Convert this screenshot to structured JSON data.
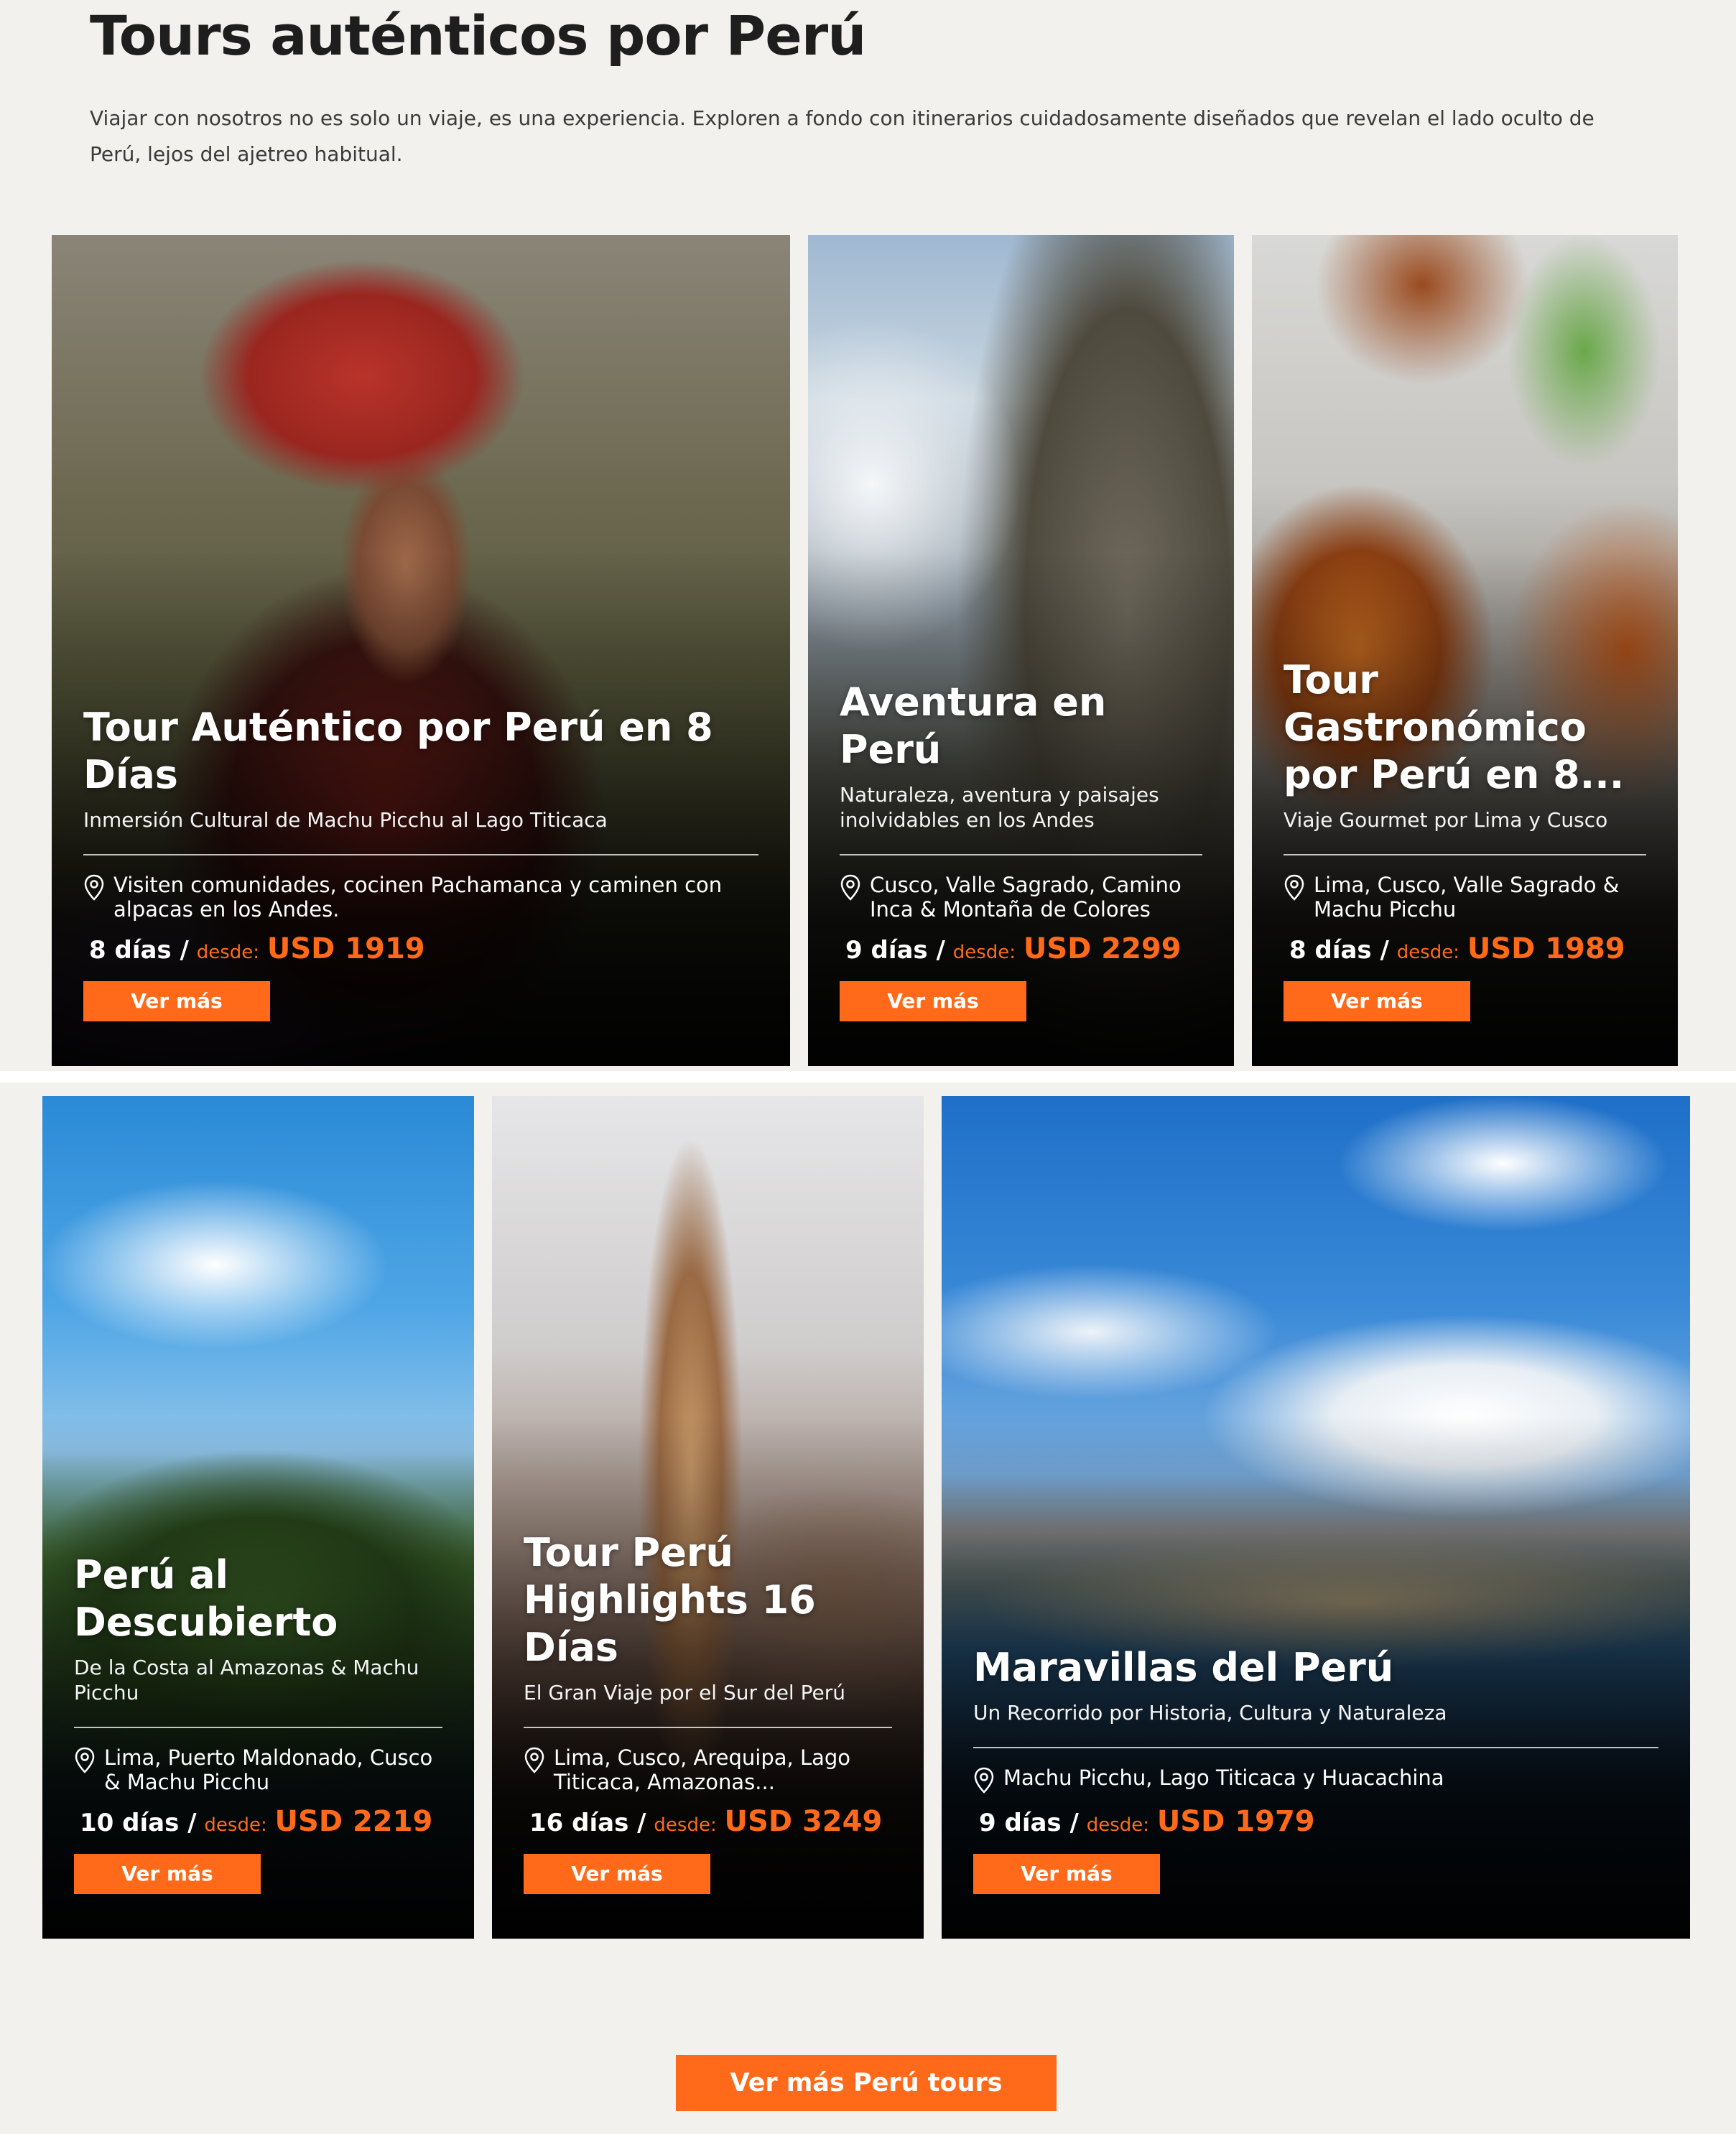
{
  "header": {
    "title": "Tours auténticos por Perú",
    "intro": "Viajar con nosotros no es solo un viaje, es una experiencia. Exploren a fondo con itinerarios cuidadosamente diseñados que revelan el lado oculto de Perú, lejos del ajetreo habitual."
  },
  "cards": [
    {
      "title": "Tour Auténtico por Perú en 8 Días",
      "subtitle": "Inmersión Cultural de Machu Picchu al Lago Titicaca",
      "location": "Visiten comunidades, cocinen Pachamanca y caminen con alpacas en los Andes.",
      "days": "8 días /",
      "from": "desde:",
      "price": "USD 1919",
      "button": "Ver más",
      "image": "woman in red traditional hat"
    },
    {
      "title": "Aventura en Perú",
      "subtitle": "Naturaleza, aventura y paisajes inolvidables en los Andes",
      "location": "Cusco, Valle Sagrado, Camino Inca & Montaña de Colores",
      "days": "9 días /",
      "from": "desde:",
      "price": "USD 2299",
      "button": "Ver más",
      "image": "rocky mountain ridge above clouds"
    },
    {
      "title": "Tour Gastronómico por Perú en 8...",
      "subtitle": "Viaje Gourmet por Lima y Cusco",
      "location": "Lima, Cusco, Valle Sagrado & Machu Picchu",
      "days": "8 días /",
      "from": "desde:",
      "price": "USD 1989",
      "button": "Ver más",
      "image": "peruvian dishes on table"
    },
    {
      "title": "Perú al Descubierto",
      "subtitle": "De la Costa al Amazonas & Machu Picchu",
      "location": "Lima, Puerto Maldonado, Cusco & Machu Picchu",
      "days": "10 días /",
      "from": "desde:",
      "price": "USD 2219",
      "button": "Ver más",
      "image": "amazon jungle and river"
    },
    {
      "title": "Tour Perú Highlights 16 Días",
      "subtitle": "El Gran Viaje por el Sur del Perú",
      "location": "Lima, Cusco, Arequipa, Lago Titicaca, Amazonas...",
      "days": "16 días /",
      "from": "desde:",
      "price": "USD 3249",
      "button": "Ver más",
      "image": "arequipa cathedral bell tower"
    },
    {
      "title": "Maravillas del Perú",
      "subtitle": "Un Recorrido por Historia, Cultura y Naturaleza",
      "location": "Machu Picchu, Lago Titicaca y Huacachina",
      "days": "9 días /",
      "from": "desde:",
      "price": "USD 1979",
      "button": "Ver más",
      "image": "lake titicaca floating islands"
    }
  ],
  "footer": {
    "button": "Ver más Perú tours"
  },
  "colors": {
    "accent": "#ff6a1a",
    "background": "#f2f1ed",
    "title": "#1e1e1e"
  }
}
